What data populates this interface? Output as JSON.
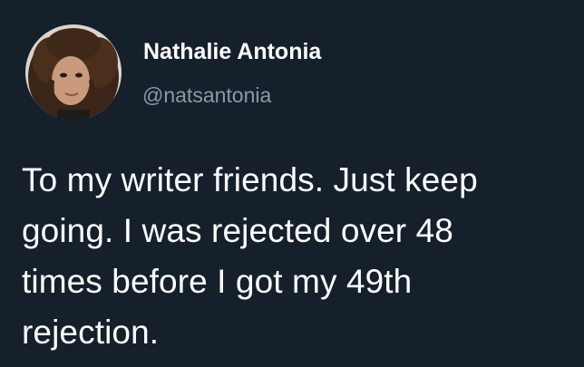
{
  "tweet": {
    "author": {
      "display_name": "Nathalie Antonia",
      "handle": "@natsantonia",
      "avatar_icon": "profile-photo-avatar"
    },
    "text_lines": [
      "To my writer friends. Just keep",
      "going. I was rejected over 48",
      "times before I got my 49th",
      "rejection."
    ]
  },
  "colors": {
    "background": "#15202b",
    "primary_text": "#ffffff",
    "secondary_text": "#8b98a5"
  }
}
